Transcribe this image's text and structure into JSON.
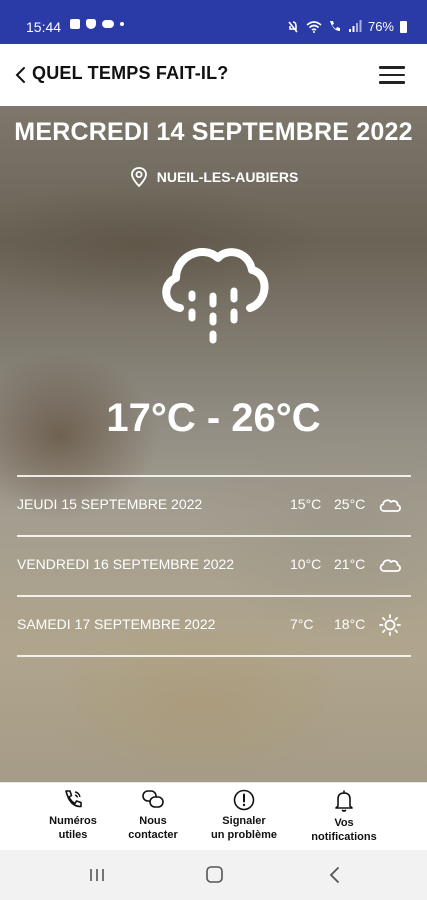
{
  "status_bar": {
    "time": "15:44",
    "battery": "76%"
  },
  "header": {
    "title": "QUEL TEMPS FAIT-IL?",
    "back_icon": "chevron-left-icon",
    "menu_icon": "hamburger-menu-icon"
  },
  "weather": {
    "date": "MERCREDI 14 SEPTEMBRE 2022",
    "location": "NUEIL-LES-AUBIERS",
    "location_icon": "map-pin-icon",
    "current_icon": "cloud-rain-icon",
    "temp_range": "17°C  -  26°C"
  },
  "forecast": [
    {
      "day": "JEUDI 15 SEPTEMBRE 2022",
      "min": "15°C",
      "max": "25°C",
      "icon": "cloud-icon"
    },
    {
      "day": "VENDREDI 16 SEPTEMBRE 2022",
      "min": "10°C",
      "max": "21°C",
      "icon": "cloud-icon"
    },
    {
      "day": "SAMEDI 17 SEPTEMBRE 2022",
      "min": "7°C",
      "max": "18°C",
      "icon": "sun-icon"
    }
  ],
  "bottom_nav": [
    {
      "label_line1": "Numéros",
      "label_line2": "utiles",
      "icon": "phone-icon"
    },
    {
      "label_line1": "Nous",
      "label_line2": "contacter",
      "icon": "chat-bubbles-icon"
    },
    {
      "label_line1": "Signaler",
      "label_line2": "un problème",
      "icon": "alert-circle-icon"
    },
    {
      "label_line1": "Vos",
      "label_line2": "notifications",
      "icon": "bell-icon"
    }
  ],
  "colors": {
    "status_bar_bg": "#2a3aa6",
    "text_on_image": "#ffffff"
  }
}
